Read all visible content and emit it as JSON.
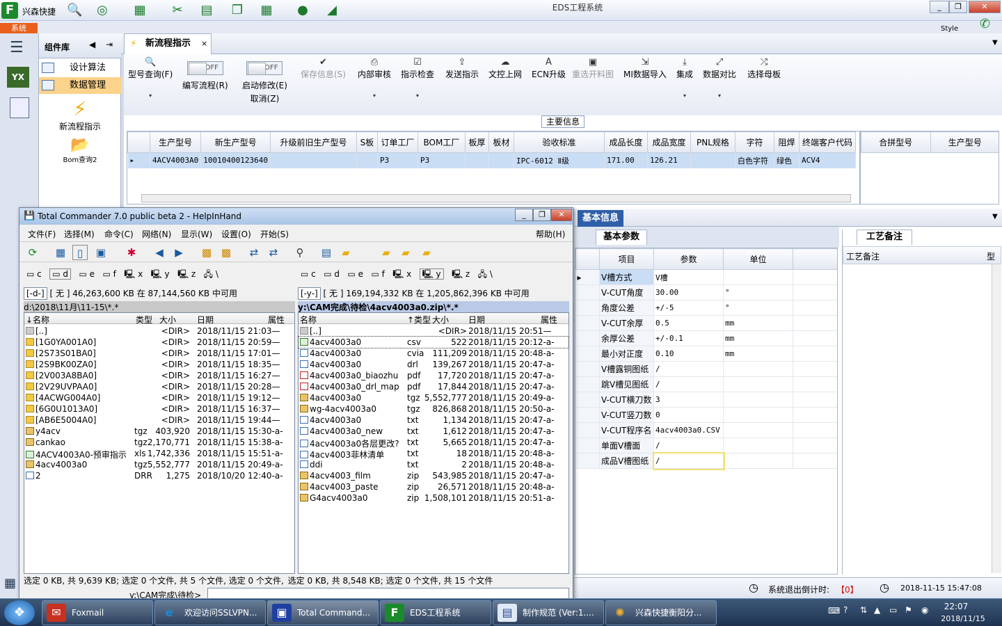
{
  "app": {
    "brand": "兴森快捷",
    "title": "EDS工程系统",
    "style_label": "Style",
    "system_tab": "系统"
  },
  "component_panel": {
    "title": "组件库",
    "items": [
      {
        "label": "设计算法"
      },
      {
        "label": "数据管理"
      }
    ],
    "big_buttons": [
      {
        "label": "新流程指示"
      },
      {
        "label": "Bom查询2"
      }
    ]
  },
  "doc_tab": {
    "label": "新流程指示"
  },
  "toolbar": {
    "search": "型号查询(F)",
    "edit_flow_toggle": "OFF",
    "edit_flow": "编写流程(R)",
    "start_modify_toggle": "OFF",
    "start_modify": "启动修改(E)",
    "cancel": "取消(Z)",
    "save_info": "保存信息(S)",
    "internal_review": "内部审核",
    "instruction_check": "指示检查",
    "send_instruction": "发送指示",
    "file_upload": "文控上网",
    "ecn_upgrade": "ECN升级",
    "reselect_material": "重选开料图",
    "mi_import": "MI数据导入",
    "integrate": "集成",
    "data_compare": "数据对比",
    "select_mother_board": "选择母板"
  },
  "main_info": {
    "label": "主要信息",
    "columns": [
      "生产型号",
      "新生产型号",
      "升级前旧生产型号",
      "S板",
      "订单工厂",
      "BOM工厂",
      "板厚",
      "板材",
      "验收标准",
      "成品长度",
      "成品宽度",
      "PNL规格",
      "字符",
      "阻焊",
      "终端客户代码"
    ],
    "row": [
      "4ACV4003A0",
      "10010400123640",
      "",
      "",
      "P3",
      "P3",
      "",
      "",
      "IPC-6012 Ⅱ级",
      "171.00",
      "126.21",
      "",
      "白色字符",
      "绿色",
      "ACV4"
    ],
    "right_columns": [
      "合拼型号",
      "生产型号"
    ]
  },
  "basic_info": {
    "tab": "基本信息",
    "subtab": "基本参数",
    "notes_tab": "工艺备注",
    "notes_col": "工艺备注",
    "notes_col2": "型",
    "columns": [
      "项目",
      "参数",
      "单位"
    ],
    "rows": [
      {
        "item": "V槽方式",
        "value": "V槽",
        "unit": ""
      },
      {
        "item": "V-CUT角度",
        "value": "30.00",
        "unit": "°"
      },
      {
        "item": "角度公差",
        "value": "+/-5",
        "unit": "°"
      },
      {
        "item": "V-CUT余厚",
        "value": "0.5",
        "unit": "mm"
      },
      {
        "item": "余厚公差",
        "value": "+/-0.1",
        "unit": "mm"
      },
      {
        "item": "最小对正度",
        "value": "0.10",
        "unit": "mm"
      },
      {
        "item": "V槽露铜图纸",
        "value": "/",
        "unit": ""
      },
      {
        "item": "跳V槽见图纸",
        "value": "/",
        "unit": ""
      },
      {
        "item": "V-CUT横刀数",
        "value": "3",
        "unit": ""
      },
      {
        "item": "V-CUT竖刀数",
        "value": "0",
        "unit": ""
      },
      {
        "item": "V-CUT程序名",
        "value": "4acv4003a0.CSV",
        "unit": ""
      },
      {
        "item": "单面V槽面",
        "value": "/",
        "unit": ""
      },
      {
        "item": "成品V槽图纸",
        "value": "/",
        "unit": ""
      }
    ],
    "status": {
      "countdown_label": "系统退出倒计时:",
      "countdown_value": "【0】",
      "datetime": "2018-11-15 15:47:08"
    }
  },
  "tc": {
    "title": "Total Commander 7.0 public beta 2 - HelpInHand",
    "menu": [
      "文件(F)",
      "选择(M)",
      "命令(C)",
      "网络(N)",
      "显示(W)",
      "设置(O)",
      "开始(S)",
      "帮助(H)"
    ],
    "left": {
      "drive_combo": "[-d-]",
      "info": "[ 无 ]  46,263,600 KB 在 87,144,560 KB 中可用",
      "path": "d:\\2018\\11月\\11-15\\*.*",
      "headers": [
        "↓名称",
        "类型",
        "大小",
        "日期",
        "属性"
      ],
      "files": [
        {
          "name": "[..]",
          "type": "",
          "size": "<DIR>",
          "date": "2018/11/15 21:03—",
          "icon": "up"
        },
        {
          "name": "[1G0YA001A0]",
          "type": "",
          "size": "<DIR>",
          "date": "2018/11/15 20:59—",
          "icon": "folder"
        },
        {
          "name": "[2S73S01BA0]",
          "type": "",
          "size": "<DIR>",
          "date": "2018/11/15 17:01—",
          "icon": "folder"
        },
        {
          "name": "[2S9BK00ZA0]",
          "type": "",
          "size": "<DIR>",
          "date": "2018/11/15 18:35—",
          "icon": "folder"
        },
        {
          "name": "[2V003A8BA0]",
          "type": "",
          "size": "<DIR>",
          "date": "2018/11/15 16:27—",
          "icon": "folder"
        },
        {
          "name": "[2V29UVPAA0]",
          "type": "",
          "size": "<DIR>",
          "date": "2018/11/15 20:28—",
          "icon": "folder"
        },
        {
          "name": "[4ACWG004A0]",
          "type": "",
          "size": "<DIR>",
          "date": "2018/11/15 19:12—",
          "icon": "folder"
        },
        {
          "name": "[6G0U1013A0]",
          "type": "",
          "size": "<DIR>",
          "date": "2018/11/15 16:37—",
          "icon": "folder"
        },
        {
          "name": "[AB6E5004A0]",
          "type": "",
          "size": "<DIR>",
          "date": "2018/11/15 19:44—",
          "icon": "folder"
        },
        {
          "name": "y4acv",
          "type": "tgz",
          "size": "403,920",
          "date": "2018/11/15 15:30-a-",
          "icon": "zip"
        },
        {
          "name": "cankao",
          "type": "tgz",
          "size": "2,170,771",
          "date": "2018/11/15 15:38-a-",
          "icon": "zip"
        },
        {
          "name": "4ACV4003A0-预审指示",
          "type": "xls",
          "size": "1,742,336",
          "date": "2018/11/15 15:51-a-",
          "icon": "xls"
        },
        {
          "name": "4acv4003a0",
          "type": "tgz",
          "size": "5,552,777",
          "date": "2018/11/15 20:49-a-",
          "icon": "zip"
        },
        {
          "name": "2",
          "type": "DRR",
          "size": "1,275",
          "date": "2018/10/20 12:40-a-",
          "icon": "doc"
        }
      ]
    },
    "right": {
      "drive_combo": "[-y-]",
      "info": "[ 无 ]  169,194,332 KB 在 1,205,862,396 KB 中可用",
      "path": "y:\\CAM完成\\待检\\4acv4003a0.zip\\*.*",
      "headers": [
        "名称",
        "↑类型",
        "大小",
        "日期",
        "属性"
      ],
      "files": [
        {
          "name": "[..]",
          "type": "",
          "size": "<DIR>",
          "date": "2018/11/15 20:51—",
          "icon": "up"
        },
        {
          "name": "4acv4003a0",
          "type": "csv",
          "size": "522",
          "date": "2018/11/15 20:12-a-",
          "icon": "xls"
        },
        {
          "name": "4acv4003a0",
          "type": "cvia",
          "size": "111,209",
          "date": "2018/11/15 20:48-a-",
          "icon": "doc"
        },
        {
          "name": "4acv4003a0",
          "type": "drl",
          "size": "139,267",
          "date": "2018/11/15 20:47-a-",
          "icon": "doc"
        },
        {
          "name": "4acv4003a0_biaozhu",
          "type": "pdf",
          "size": "17,720",
          "date": "2018/11/15 20:47-a-",
          "icon": "pdf"
        },
        {
          "name": "4acv4003a0_drl_map",
          "type": "pdf",
          "size": "17,844",
          "date": "2018/11/15 20:47-a-",
          "icon": "pdf"
        },
        {
          "name": "4acv4003a0",
          "type": "tgz",
          "size": "5,552,777",
          "date": "2018/11/15 20:49-a-",
          "icon": "zip"
        },
        {
          "name": "wg-4acv4003a0",
          "type": "tgz",
          "size": "826,868",
          "date": "2018/11/15 20:50-a-",
          "icon": "zip"
        },
        {
          "name": "4acv4003a0",
          "type": "txt",
          "size": "1,134",
          "date": "2018/11/15 20:47-a-",
          "icon": "doc"
        },
        {
          "name": "4acv4003a0_new",
          "type": "txt",
          "size": "1,612",
          "date": "2018/11/15 20:47-a-",
          "icon": "doc"
        },
        {
          "name": "4acv4003a0各层更改?",
          "type": "txt",
          "size": "5,665",
          "date": "2018/11/15 20:47-a-",
          "icon": "doc"
        },
        {
          "name": "4acv4003菲林清单",
          "type": "txt",
          "size": "18",
          "date": "2018/11/15 20:48-a-",
          "icon": "doc"
        },
        {
          "name": "ddi",
          "type": "txt",
          "size": "2",
          "date": "2018/11/15 20:48-a-",
          "icon": "doc"
        },
        {
          "name": "4acv4003_film",
          "type": "zip",
          "size": "543,985",
          "date": "2018/11/15 20:47-a-",
          "icon": "zip"
        },
        {
          "name": "4acv4003_paste",
          "type": "zip",
          "size": "26,571",
          "date": "2018/11/15 20:48-a-",
          "icon": "zip"
        },
        {
          "name": "G4acv4003a0",
          "type": "zip",
          "size": "1,508,101",
          "date": "2018/11/15 20:51-a-",
          "icon": "zip"
        }
      ]
    },
    "status_left": "选定 0 KB, 共 9,639 KB; 选定 0 个文件, 共 5 个文件, 选定 0 个文件,",
    "status_right": "选定 0 KB, 共 8,548 KB; 选定 0 个文件, 共 15 个文件",
    "cmdline": "y:\\CAM完成\\待检>"
  },
  "taskbar": {
    "tasks": [
      {
        "label": "Foxmail"
      },
      {
        "label": "欢迎访问SSLVPN..."
      },
      {
        "label": "Total Command..."
      },
      {
        "label": "EDS工程系统"
      },
      {
        "label": "制作规范 (Ver:1...."
      },
      {
        "label": "兴森快捷衡阳分..."
      }
    ],
    "time": "22:07",
    "date": "2018/11/15"
  },
  "colors": {
    "accent_orange": "#e8601c",
    "selection_blue": "#c9ddf5",
    "brand_green": "#1a8a2a"
  }
}
